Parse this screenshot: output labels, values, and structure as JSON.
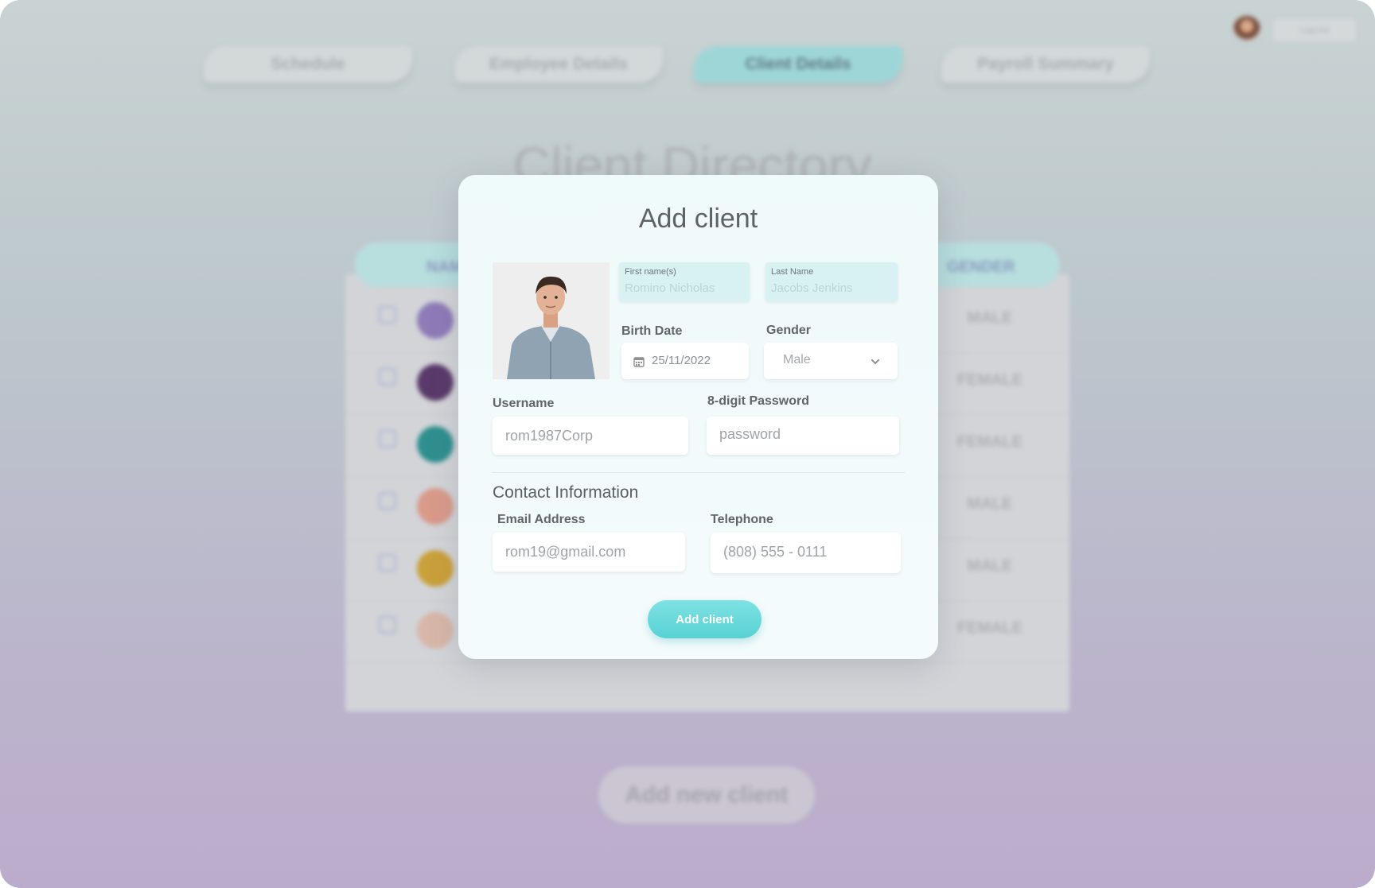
{
  "nav": {
    "tabs": [
      {
        "label": "Schedule"
      },
      {
        "label": "Employee Details"
      },
      {
        "label": "Client Details"
      },
      {
        "label": "Payroll Summary"
      }
    ],
    "active_tab": "Client Details",
    "logout_label": "Log out"
  },
  "background": {
    "page_title": "Client Directory",
    "headers": {
      "name": "NAM",
      "gender": "GENDER"
    },
    "rows": [
      {
        "gender": "MALE"
      },
      {
        "gender": "FEMALE"
      },
      {
        "gender": "FEMALE"
      },
      {
        "gender": "MALE"
      },
      {
        "gender": "MALE"
      },
      {
        "gender": "FEMALE"
      }
    ],
    "add_new_label": "Add new client"
  },
  "modal": {
    "title": "Add client",
    "first_name": {
      "label": "First name(s)",
      "value": "Romino Nicholas"
    },
    "last_name": {
      "label": "Last Name",
      "value": "Jacobs Jenkins"
    },
    "birth_date": {
      "label": "Birth Date",
      "value": "25/11/2022"
    },
    "gender": {
      "label": "Gender",
      "value": "Male"
    },
    "username": {
      "label": "Username",
      "placeholder": "rom1987Corp"
    },
    "password": {
      "label": "8-digit Password",
      "placeholder": "password"
    },
    "contact_heading": "Contact Information",
    "email": {
      "label": "Email Address",
      "placeholder": "rom19@gmail.com"
    },
    "telephone": {
      "label": "Telephone",
      "placeholder": "(808) 555 - 0111"
    },
    "submit_label": "Add client"
  },
  "colors": {
    "accent": "#58d2d4",
    "active_tab": "#9ed6d8",
    "name_field_bg": "#d8f2f3"
  }
}
